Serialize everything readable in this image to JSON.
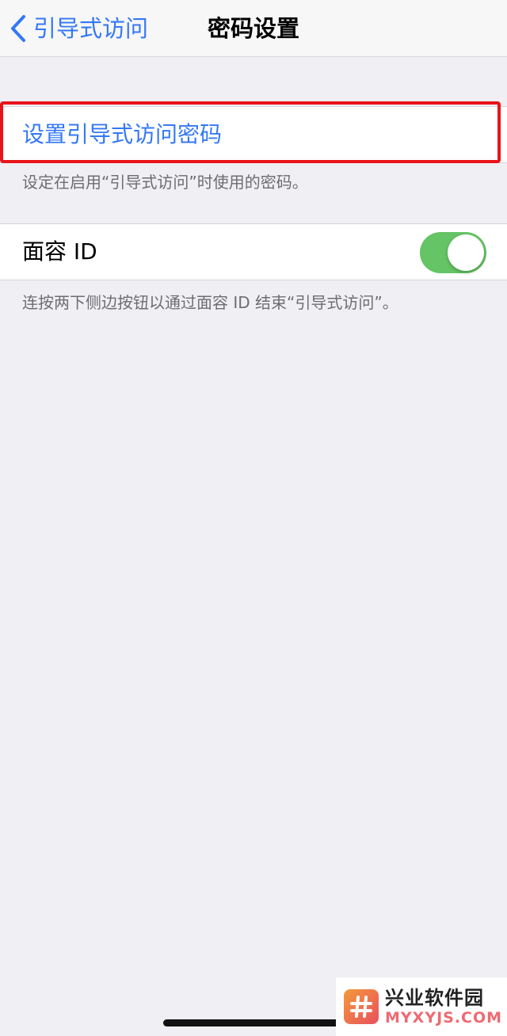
{
  "navbar": {
    "back_label": "引导式访问",
    "title": "密码设置"
  },
  "passcode_group": {
    "set_passcode_label": "设置引导式访问密码",
    "note": "设定在启用“引导式访问”时使用的密码。"
  },
  "faceid_group": {
    "label": "面容 ID",
    "toggle_on": true,
    "note": "连按两下侧边按钮以通过面容 ID 结束“引导式访问”。"
  },
  "watermark": {
    "name": "兴业软件园",
    "domain": "MYXYJS.COM"
  },
  "colors": {
    "accent": "#3478f6",
    "toggle_on": "#65c466",
    "highlight": "#e8141a",
    "background": "#efeff4"
  },
  "icons": {
    "back": "chevron-left-icon",
    "logo": "hash-logo-icon"
  }
}
